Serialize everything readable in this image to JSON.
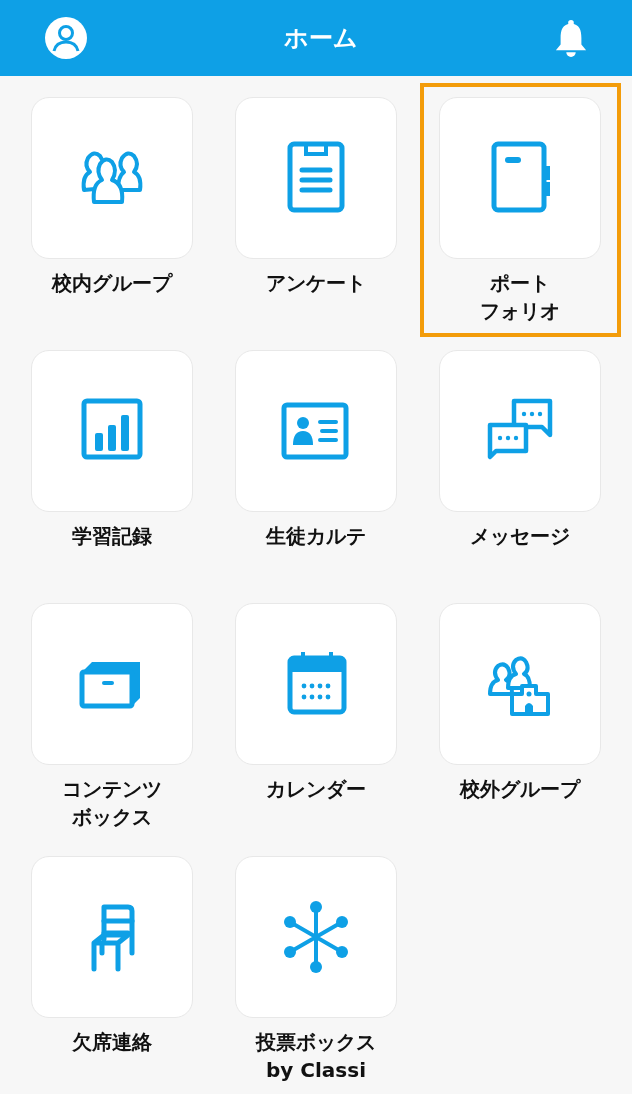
{
  "header": {
    "title": "ホーム"
  },
  "items": [
    {
      "kind": "group",
      "label_lines": [
        "校内グループ"
      ],
      "highlighted": false
    },
    {
      "kind": "clipboard",
      "label_lines": [
        "アンケート"
      ],
      "highlighted": false
    },
    {
      "kind": "notebook",
      "label_lines": [
        "ポート",
        "フォリオ"
      ],
      "highlighted": true
    },
    {
      "kind": "chart",
      "label_lines": [
        "学習記録"
      ],
      "highlighted": false
    },
    {
      "kind": "idcard",
      "label_lines": [
        "生徒カルテ"
      ],
      "highlighted": false
    },
    {
      "kind": "chat",
      "label_lines": [
        "メッセージ"
      ],
      "highlighted": false
    },
    {
      "kind": "box",
      "label_lines": [
        "コンテンツ",
        "ボックス"
      ],
      "highlighted": false
    },
    {
      "kind": "calendar",
      "label_lines": [
        "カレンダー"
      ],
      "highlighted": false
    },
    {
      "kind": "school",
      "label_lines": [
        "校外グループ"
      ],
      "highlighted": false
    },
    {
      "kind": "chair",
      "label_lines": [
        "欠席連絡"
      ],
      "highlighted": false
    },
    {
      "kind": "network",
      "label_lines": [
        "投票ボックス",
        "by Classi"
      ],
      "highlighted": false
    }
  ]
}
